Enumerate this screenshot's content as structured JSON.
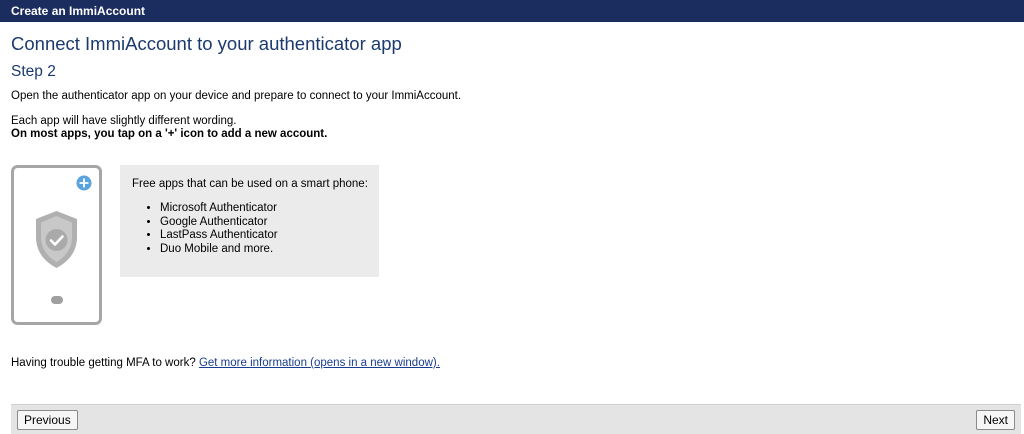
{
  "header": {
    "title": "Create an ImmiAccount"
  },
  "main": {
    "heading": "Connect ImmiAccount to your authenticator app",
    "step": "Step 2",
    "instruction": "Open the authenticator app on your device and prepare to connect to your ImmiAccount.",
    "note": "Each app will have slightly different wording.",
    "note_bold": "On most apps, you tap on a '+' icon to add a new account."
  },
  "infobox": {
    "intro": "Free apps that can be used on a smart phone:",
    "apps": [
      "Microsoft Authenticator",
      "Google Authenticator",
      "LastPass Authenticator",
      "Duo Mobile and more."
    ]
  },
  "help": {
    "text": "Having trouble getting MFA to work?",
    "link": "Get more information (opens in a new window)."
  },
  "footer": {
    "previous_label": "Previous",
    "next_label": "Next"
  },
  "colors": {
    "header_bg": "#1b2c5e",
    "heading": "#1c3a6e",
    "link": "#1a3d8f",
    "plus_icon": "#5aa3dc"
  }
}
